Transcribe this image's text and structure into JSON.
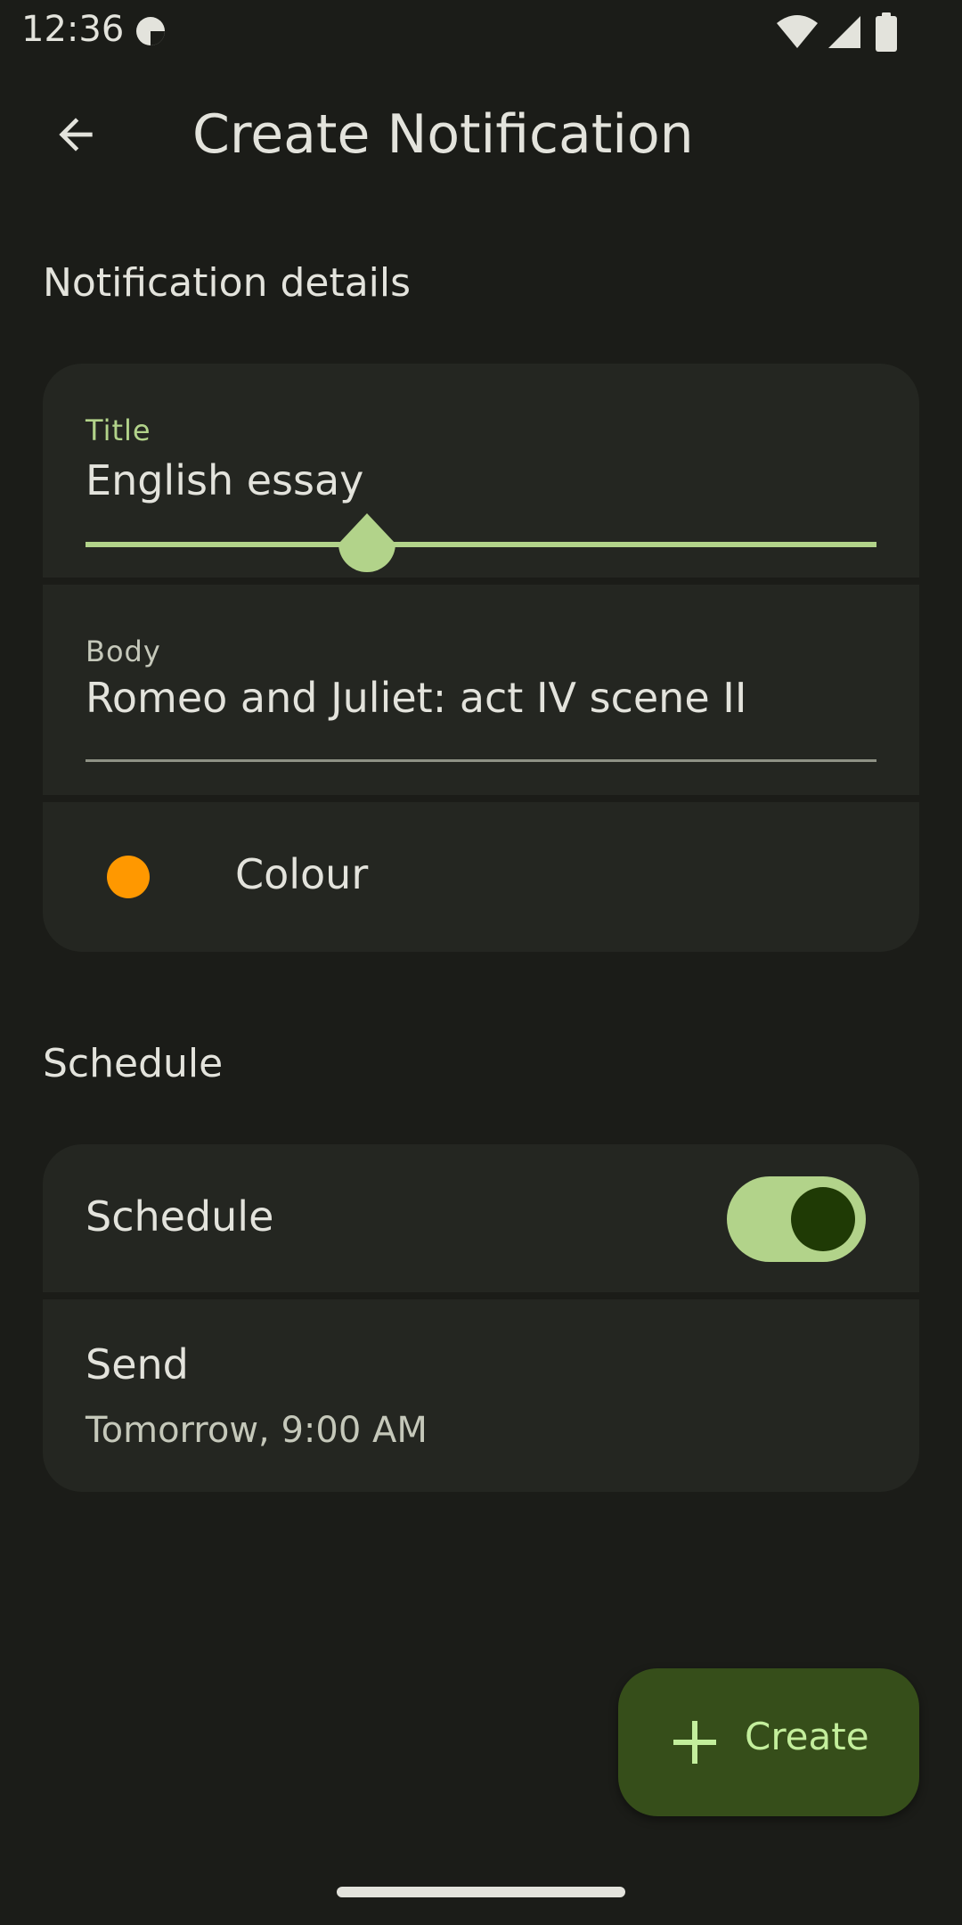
{
  "status_bar": {
    "time": "12:36",
    "app_icon": "notification-app-icon",
    "icons": [
      "wifi-icon",
      "signal-icon",
      "battery-icon"
    ]
  },
  "app_bar": {
    "title": "Create Notification",
    "back_icon": "arrow-back-icon"
  },
  "notification_details": {
    "section_title": "Notification details",
    "title_field": {
      "label": "Title",
      "value": "English essay",
      "cursor_position": 0.36
    },
    "body_field": {
      "label": "Body",
      "value": "Romeo and Juliet: act IV scene II"
    },
    "colour_row": {
      "label": "Colour",
      "swatch_color": "#ff9800"
    }
  },
  "schedule": {
    "section_title": "Schedule",
    "toggle_row": {
      "label": "Schedule",
      "enabled": true
    },
    "send_row": {
      "title": "Send",
      "value": "Tomorrow, 9:00 AM"
    }
  },
  "fab": {
    "label": "Create",
    "icon": "plus-icon"
  },
  "colors": {
    "background": "#1b1c18",
    "surface": "#242621",
    "primary": "#b2d38a",
    "on_surface": "#e3e3dc",
    "on_surface_variant": "#c5c8ba",
    "fab_container": "#364e1a",
    "fab_content": "#c3ee9c",
    "outline": "#8f9285"
  }
}
